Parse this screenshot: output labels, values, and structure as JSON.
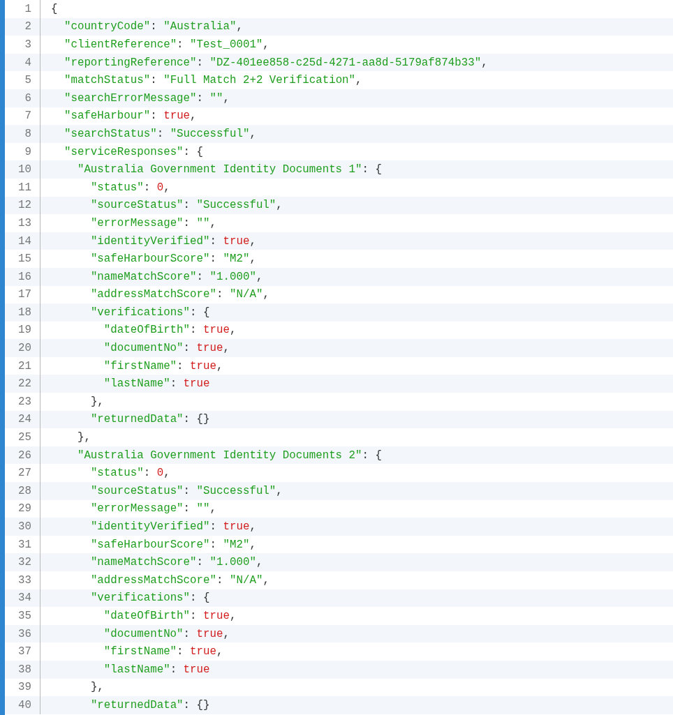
{
  "editor": {
    "lines": [
      {
        "number": "1",
        "tokens": [
          {
            "kind": "punct",
            "text": "{"
          }
        ],
        "children": [
          {
            "number": "2",
            "tokens": [
              {
                "kind": "string",
                "text": "\"countryCode\""
              },
              {
                "kind": "punct",
                "text": ": "
              },
              {
                "kind": "string",
                "text": "\"Australia\""
              },
              {
                "kind": "punct",
                "text": ","
              }
            ]
          },
          {
            "number": "3",
            "tokens": [
              {
                "kind": "string",
                "text": "\"clientReference\""
              },
              {
                "kind": "punct",
                "text": ": "
              },
              {
                "kind": "string",
                "text": "\"Test_0001\""
              },
              {
                "kind": "punct",
                "text": ","
              }
            ]
          },
          {
            "number": "4",
            "tokens": [
              {
                "kind": "string",
                "text": "\"reportingReference\""
              },
              {
                "kind": "punct",
                "text": ": "
              },
              {
                "kind": "string",
                "text": "\"DZ-401ee858-c25d-4271-aa8d-5179af874b33\""
              },
              {
                "kind": "punct",
                "text": ","
              }
            ]
          },
          {
            "number": "5",
            "tokens": [
              {
                "kind": "string",
                "text": "\"matchStatus\""
              },
              {
                "kind": "punct",
                "text": ": "
              },
              {
                "kind": "string",
                "text": "\"Full Match 2+2 Verification\""
              },
              {
                "kind": "punct",
                "text": ","
              }
            ]
          },
          {
            "number": "6",
            "tokens": [
              {
                "kind": "string",
                "text": "\"searchErrorMessage\""
              },
              {
                "kind": "punct",
                "text": ": "
              },
              {
                "kind": "string",
                "text": "\"\""
              },
              {
                "kind": "punct",
                "text": ","
              }
            ]
          },
          {
            "number": "7",
            "tokens": [
              {
                "kind": "string",
                "text": "\"safeHarbour\""
              },
              {
                "kind": "punct",
                "text": ": "
              },
              {
                "kind": "literal",
                "text": "true"
              },
              {
                "kind": "punct",
                "text": ","
              }
            ]
          },
          {
            "number": "8",
            "tokens": [
              {
                "kind": "string",
                "text": "\"searchStatus\""
              },
              {
                "kind": "punct",
                "text": ": "
              },
              {
                "kind": "string",
                "text": "\"Successful\""
              },
              {
                "kind": "punct",
                "text": ","
              }
            ]
          },
          {
            "number": "9",
            "tokens": [
              {
                "kind": "string",
                "text": "\"serviceResponses\""
              },
              {
                "kind": "punct",
                "text": ": {"
              }
            ],
            "children": [
              {
                "number": "10",
                "tokens": [
                  {
                    "kind": "string",
                    "text": "\"Australia Government Identity Documents 1\""
                  },
                  {
                    "kind": "punct",
                    "text": ": {"
                  }
                ],
                "children": [
                  {
                    "number": "11",
                    "tokens": [
                      {
                        "kind": "string",
                        "text": "\"status\""
                      },
                      {
                        "kind": "punct",
                        "text": ": "
                      },
                      {
                        "kind": "literal",
                        "text": "0"
                      },
                      {
                        "kind": "punct",
                        "text": ","
                      }
                    ]
                  },
                  {
                    "number": "12",
                    "tokens": [
                      {
                        "kind": "string",
                        "text": "\"sourceStatus\""
                      },
                      {
                        "kind": "punct",
                        "text": ": "
                      },
                      {
                        "kind": "string",
                        "text": "\"Successful\""
                      },
                      {
                        "kind": "punct",
                        "text": ","
                      }
                    ]
                  },
                  {
                    "number": "13",
                    "tokens": [
                      {
                        "kind": "string",
                        "text": "\"errorMessage\""
                      },
                      {
                        "kind": "punct",
                        "text": ": "
                      },
                      {
                        "kind": "string",
                        "text": "\"\""
                      },
                      {
                        "kind": "punct",
                        "text": ","
                      }
                    ]
                  },
                  {
                    "number": "14",
                    "tokens": [
                      {
                        "kind": "string",
                        "text": "\"identityVerified\""
                      },
                      {
                        "kind": "punct",
                        "text": ": "
                      },
                      {
                        "kind": "literal",
                        "text": "true"
                      },
                      {
                        "kind": "punct",
                        "text": ","
                      }
                    ]
                  },
                  {
                    "number": "15",
                    "tokens": [
                      {
                        "kind": "string",
                        "text": "\"safeHarbourScore\""
                      },
                      {
                        "kind": "punct",
                        "text": ": "
                      },
                      {
                        "kind": "string",
                        "text": "\"M2\""
                      },
                      {
                        "kind": "punct",
                        "text": ","
                      }
                    ]
                  },
                  {
                    "number": "16",
                    "tokens": [
                      {
                        "kind": "string",
                        "text": "\"nameMatchScore\""
                      },
                      {
                        "kind": "punct",
                        "text": ": "
                      },
                      {
                        "kind": "string",
                        "text": "\"1.000\""
                      },
                      {
                        "kind": "punct",
                        "text": ","
                      }
                    ]
                  },
                  {
                    "number": "17",
                    "tokens": [
                      {
                        "kind": "string",
                        "text": "\"addressMatchScore\""
                      },
                      {
                        "kind": "punct",
                        "text": ": "
                      },
                      {
                        "kind": "string",
                        "text": "\"N/A\""
                      },
                      {
                        "kind": "punct",
                        "text": ","
                      }
                    ]
                  },
                  {
                    "number": "18",
                    "tokens": [
                      {
                        "kind": "string",
                        "text": "\"verifications\""
                      },
                      {
                        "kind": "punct",
                        "text": ": {"
                      }
                    ],
                    "children": [
                      {
                        "number": "19",
                        "tokens": [
                          {
                            "kind": "string",
                            "text": "\"dateOfBirth\""
                          },
                          {
                            "kind": "punct",
                            "text": ": "
                          },
                          {
                            "kind": "literal",
                            "text": "true"
                          },
                          {
                            "kind": "punct",
                            "text": ","
                          }
                        ]
                      },
                      {
                        "number": "20",
                        "tokens": [
                          {
                            "kind": "string",
                            "text": "\"documentNo\""
                          },
                          {
                            "kind": "punct",
                            "text": ": "
                          },
                          {
                            "kind": "literal",
                            "text": "true"
                          },
                          {
                            "kind": "punct",
                            "text": ","
                          }
                        ]
                      },
                      {
                        "number": "21",
                        "tokens": [
                          {
                            "kind": "string",
                            "text": "\"firstName\""
                          },
                          {
                            "kind": "punct",
                            "text": ": "
                          },
                          {
                            "kind": "literal",
                            "text": "true"
                          },
                          {
                            "kind": "punct",
                            "text": ","
                          }
                        ]
                      },
                      {
                        "number": "22",
                        "tokens": [
                          {
                            "kind": "string",
                            "text": "\"lastName\""
                          },
                          {
                            "kind": "punct",
                            "text": ": "
                          },
                          {
                            "kind": "literal",
                            "text": "true"
                          }
                        ]
                      }
                    ]
                  },
                  {
                    "number": "23",
                    "tokens": [
                      {
                        "kind": "punct",
                        "text": "},"
                      }
                    ]
                  },
                  {
                    "number": "24",
                    "tokens": [
                      {
                        "kind": "string",
                        "text": "\"returnedData\""
                      },
                      {
                        "kind": "punct",
                        "text": ": {}"
                      }
                    ]
                  }
                ]
              },
              {
                "number": "25",
                "tokens": [
                  {
                    "kind": "punct",
                    "text": "},"
                  }
                ]
              },
              {
                "number": "26",
                "tokens": [
                  {
                    "kind": "string",
                    "text": "\"Australia Government Identity Documents 2\""
                  },
                  {
                    "kind": "punct",
                    "text": ": {"
                  }
                ],
                "children": [
                  {
                    "number": "27",
                    "tokens": [
                      {
                        "kind": "string",
                        "text": "\"status\""
                      },
                      {
                        "kind": "punct",
                        "text": ": "
                      },
                      {
                        "kind": "literal",
                        "text": "0"
                      },
                      {
                        "kind": "punct",
                        "text": ","
                      }
                    ]
                  },
                  {
                    "number": "28",
                    "tokens": [
                      {
                        "kind": "string",
                        "text": "\"sourceStatus\""
                      },
                      {
                        "kind": "punct",
                        "text": ": "
                      },
                      {
                        "kind": "string",
                        "text": "\"Successful\""
                      },
                      {
                        "kind": "punct",
                        "text": ","
                      }
                    ]
                  },
                  {
                    "number": "29",
                    "tokens": [
                      {
                        "kind": "string",
                        "text": "\"errorMessage\""
                      },
                      {
                        "kind": "punct",
                        "text": ": "
                      },
                      {
                        "kind": "string",
                        "text": "\"\""
                      },
                      {
                        "kind": "punct",
                        "text": ","
                      }
                    ]
                  },
                  {
                    "number": "30",
                    "tokens": [
                      {
                        "kind": "string",
                        "text": "\"identityVerified\""
                      },
                      {
                        "kind": "punct",
                        "text": ": "
                      },
                      {
                        "kind": "literal",
                        "text": "true"
                      },
                      {
                        "kind": "punct",
                        "text": ","
                      }
                    ]
                  },
                  {
                    "number": "31",
                    "tokens": [
                      {
                        "kind": "string",
                        "text": "\"safeHarbourScore\""
                      },
                      {
                        "kind": "punct",
                        "text": ": "
                      },
                      {
                        "kind": "string",
                        "text": "\"M2\""
                      },
                      {
                        "kind": "punct",
                        "text": ","
                      }
                    ]
                  },
                  {
                    "number": "32",
                    "tokens": [
                      {
                        "kind": "string",
                        "text": "\"nameMatchScore\""
                      },
                      {
                        "kind": "punct",
                        "text": ": "
                      },
                      {
                        "kind": "string",
                        "text": "\"1.000\""
                      },
                      {
                        "kind": "punct",
                        "text": ","
                      }
                    ]
                  },
                  {
                    "number": "33",
                    "tokens": [
                      {
                        "kind": "string",
                        "text": "\"addressMatchScore\""
                      },
                      {
                        "kind": "punct",
                        "text": ": "
                      },
                      {
                        "kind": "string",
                        "text": "\"N/A\""
                      },
                      {
                        "kind": "punct",
                        "text": ","
                      }
                    ]
                  },
                  {
                    "number": "34",
                    "tokens": [
                      {
                        "kind": "string",
                        "text": "\"verifications\""
                      },
                      {
                        "kind": "punct",
                        "text": ": {"
                      }
                    ],
                    "children": [
                      {
                        "number": "35",
                        "tokens": [
                          {
                            "kind": "string",
                            "text": "\"dateOfBirth\""
                          },
                          {
                            "kind": "punct",
                            "text": ": "
                          },
                          {
                            "kind": "literal",
                            "text": "true"
                          },
                          {
                            "kind": "punct",
                            "text": ","
                          }
                        ]
                      },
                      {
                        "number": "36",
                        "tokens": [
                          {
                            "kind": "string",
                            "text": "\"documentNo\""
                          },
                          {
                            "kind": "punct",
                            "text": ": "
                          },
                          {
                            "kind": "literal",
                            "text": "true"
                          },
                          {
                            "kind": "punct",
                            "text": ","
                          }
                        ]
                      },
                      {
                        "number": "37",
                        "tokens": [
                          {
                            "kind": "string",
                            "text": "\"firstName\""
                          },
                          {
                            "kind": "punct",
                            "text": ": "
                          },
                          {
                            "kind": "literal",
                            "text": "true"
                          },
                          {
                            "kind": "punct",
                            "text": ","
                          }
                        ]
                      },
                      {
                        "number": "38",
                        "tokens": [
                          {
                            "kind": "string",
                            "text": "\"lastName\""
                          },
                          {
                            "kind": "punct",
                            "text": ": "
                          },
                          {
                            "kind": "literal",
                            "text": "true"
                          }
                        ]
                      }
                    ]
                  },
                  {
                    "number": "39",
                    "tokens": [
                      {
                        "kind": "punct",
                        "text": "},"
                      }
                    ]
                  },
                  {
                    "number": "40",
                    "tokens": [
                      {
                        "kind": "string",
                        "text": "\"returnedData\""
                      },
                      {
                        "kind": "punct",
                        "text": ": {}"
                      }
                    ]
                  }
                ]
              }
            ]
          }
        ]
      }
    ]
  }
}
